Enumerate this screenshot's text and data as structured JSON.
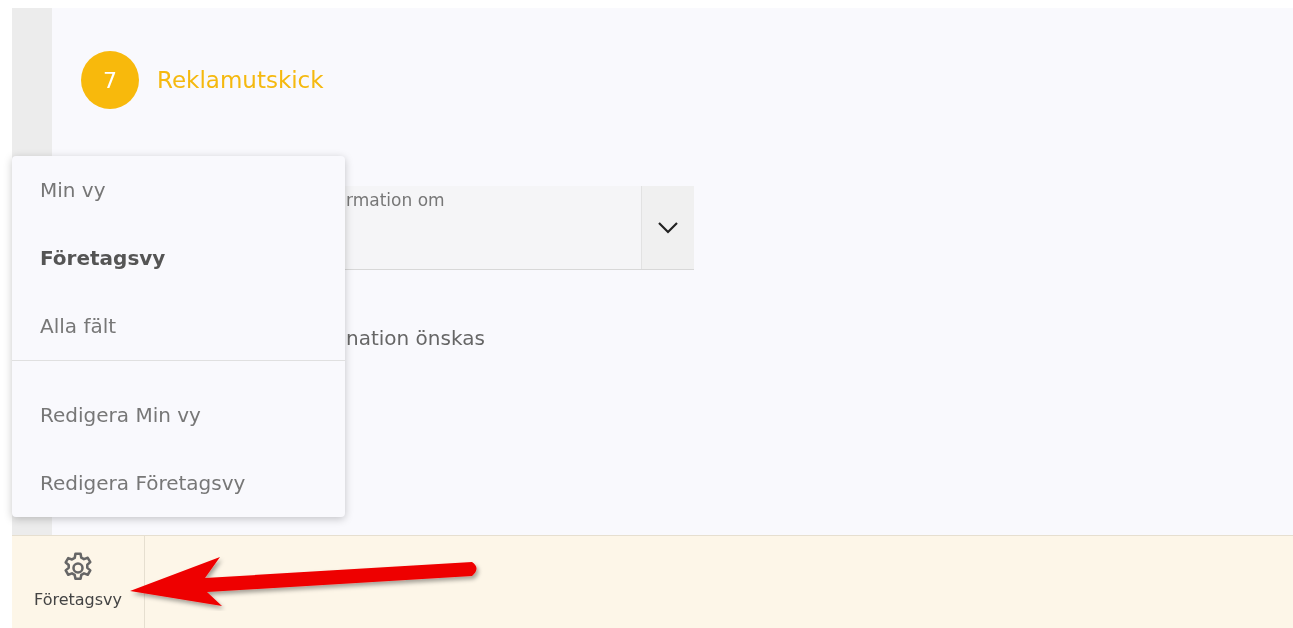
{
  "section": {
    "number": "7",
    "title": "Reklamutskick"
  },
  "select_field": {
    "label": "rmation om"
  },
  "question": {
    "text": "nation önskas"
  },
  "view_menu": {
    "items": [
      {
        "label": "Min vy",
        "kind": "view",
        "selected": false
      },
      {
        "label": "Företagsvy",
        "kind": "view",
        "selected": true
      },
      {
        "label": "Alla fält",
        "kind": "view",
        "selected": false
      },
      {
        "label": "Redigera Min vy",
        "kind": "action",
        "selected": false
      },
      {
        "label": "Redigera Företagsvy",
        "kind": "action",
        "selected": false
      }
    ]
  },
  "bottom_bar": {
    "view_button": {
      "label": "Företagsvy"
    }
  }
}
